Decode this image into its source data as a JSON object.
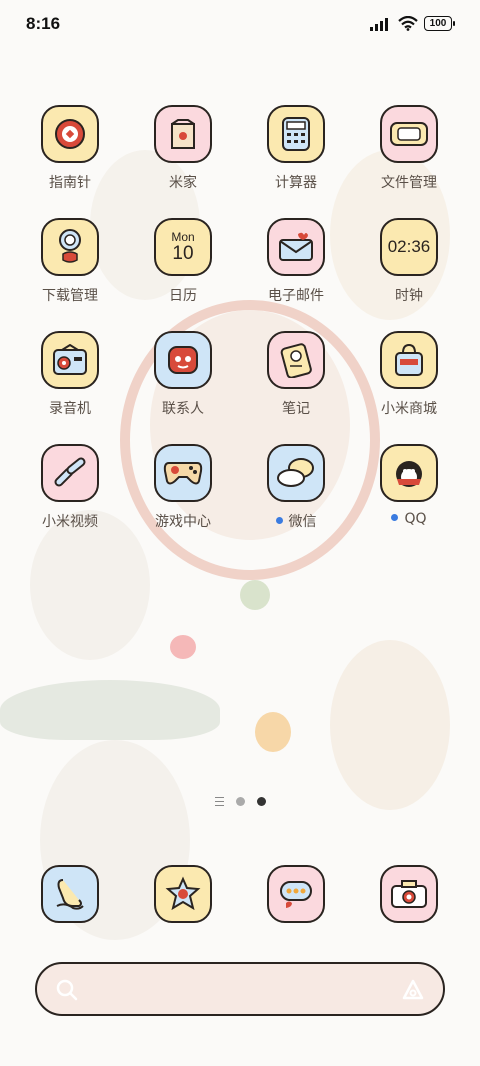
{
  "status_bar": {
    "time": "8:16",
    "battery": "100"
  },
  "apps": [
    {
      "label": "指南针",
      "icon": "compass-icon",
      "bg": "yellow"
    },
    {
      "label": "米家",
      "icon": "mi-home-icon",
      "bg": "pink"
    },
    {
      "label": "计算器",
      "icon": "calculator-icon",
      "bg": "yellow"
    },
    {
      "label": "文件管理",
      "icon": "file-manager-icon",
      "bg": "pink"
    },
    {
      "label": "下载管理",
      "icon": "download-manager-icon",
      "bg": "yellow"
    },
    {
      "label": "日历",
      "icon": "calendar-icon",
      "bg": "yellow",
      "day_text": "Mon",
      "date_text": "10"
    },
    {
      "label": "电子邮件",
      "icon": "email-icon",
      "bg": "pink"
    },
    {
      "label": "时钟",
      "icon": "clock-icon",
      "bg": "yellow",
      "clock_text": "02:36"
    },
    {
      "label": "录音机",
      "icon": "recorder-icon",
      "bg": "yellow"
    },
    {
      "label": "联系人",
      "icon": "contacts-icon",
      "bg": "blue"
    },
    {
      "label": "笔记",
      "icon": "notes-icon",
      "bg": "pink"
    },
    {
      "label": "小米商城",
      "icon": "mi-store-icon",
      "bg": "yellow"
    },
    {
      "label": "小米视频",
      "icon": "mi-video-icon",
      "bg": "pink"
    },
    {
      "label": "游戏中心",
      "icon": "game-center-icon",
      "bg": "blue"
    },
    {
      "label": "微信",
      "icon": "wechat-icon",
      "bg": "blue",
      "notify": true
    },
    {
      "label": "QQ",
      "icon": "qq-icon",
      "bg": "yellow",
      "notify": true
    }
  ],
  "dock": [
    {
      "icon": "phone-icon",
      "bg": "blue"
    },
    {
      "icon": "browser-icon",
      "bg": "yellow"
    },
    {
      "icon": "messages-icon",
      "bg": "pink"
    },
    {
      "icon": "camera-icon",
      "bg": "pink"
    }
  ],
  "pager": {
    "pages": 2,
    "active": 2
  },
  "search": {
    "placeholder": ""
  }
}
